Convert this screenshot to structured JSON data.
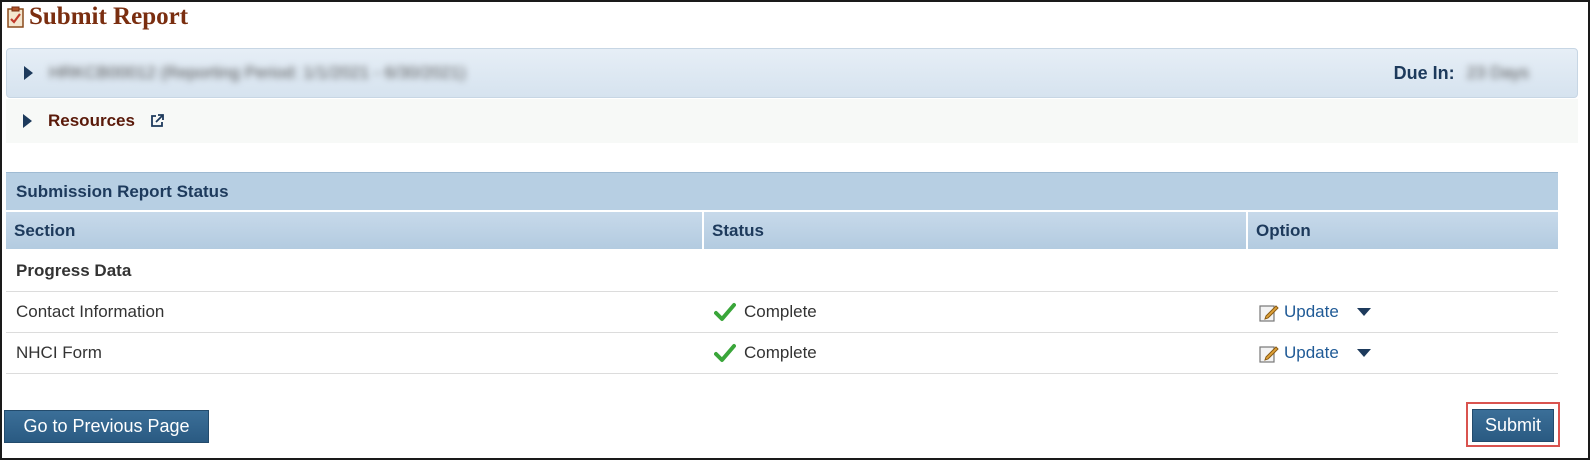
{
  "page": {
    "title": "Submit Report"
  },
  "report_header": {
    "report_name": "HRKCB00012 (Reporting Period: 1/1/2021 - 6/30/2021)",
    "due_label": "Due In:",
    "due_value": "23 Days"
  },
  "resources": {
    "label": "Resources"
  },
  "status_panel": {
    "title": "Submission Report Status",
    "columns": [
      "Section",
      "Status",
      "Option"
    ],
    "group_label": "Progress Data",
    "rows": [
      {
        "section": "Contact Information",
        "status": "Complete",
        "option": "Update"
      },
      {
        "section": "NHCI Form",
        "status": "Complete",
        "option": "Update"
      }
    ]
  },
  "buttons": {
    "previous": "Go to Previous Page",
    "submit": "Submit"
  },
  "colors": {
    "title": "#7a2e10",
    "header_blue": "#1d3a5c",
    "button": "#2f628b",
    "link": "#1f5a96",
    "highlight": "#d9534f",
    "check": "#3aa63a"
  }
}
